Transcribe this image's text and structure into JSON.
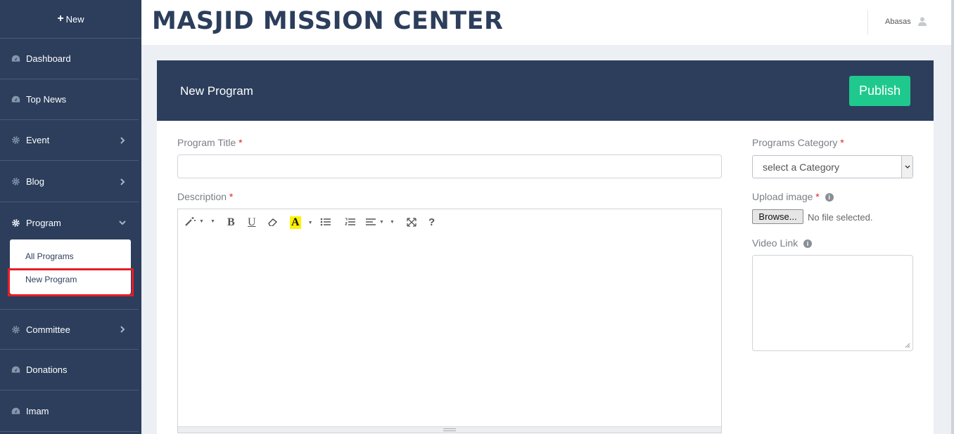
{
  "sidebar": {
    "new_label": "New",
    "items": [
      {
        "label": "Dashboard"
      },
      {
        "label": "Top News"
      },
      {
        "label": "Event"
      },
      {
        "label": "Blog"
      },
      {
        "label": "Program"
      },
      {
        "label": "Committee"
      },
      {
        "label": "Donations"
      },
      {
        "label": "Imam"
      }
    ],
    "submenu": [
      {
        "label": "All Programs"
      },
      {
        "label": "New Program"
      }
    ]
  },
  "header": {
    "brand": "MASJID MISSION CENTER",
    "user_name": "Abasas"
  },
  "card": {
    "title": "New Program",
    "publish_label": "Publish"
  },
  "form": {
    "program_title_label": "Program Title",
    "description_label": "Description",
    "category_label": "Programs Category",
    "category_selected": "select a Category",
    "upload_label": "Upload image",
    "browse_label": "Browse...",
    "no_file_text": "No file selected.",
    "video_label": "Video Link",
    "required_mark": "*"
  },
  "toolbar": {
    "bold": "B",
    "underline": "U",
    "highlight": "A",
    "help": "?"
  },
  "colors": {
    "sidebar_bg": "#2c3e5c",
    "publish_bg": "#1fc98e",
    "required": "#e41e26",
    "highlight_box": "#e41e26"
  }
}
